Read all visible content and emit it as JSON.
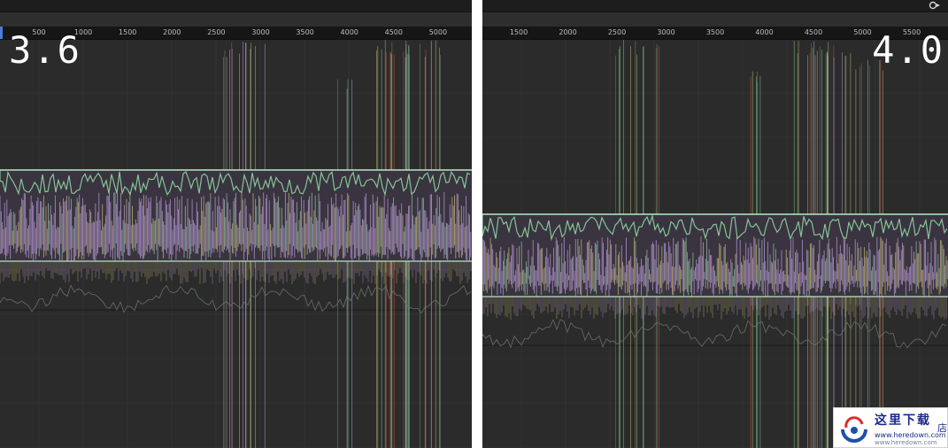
{
  "left_panel": {
    "version_label": "3.6",
    "ruler_ticks": [
      "500",
      "1000",
      "1500",
      "2000",
      "2500",
      "3000",
      "3500",
      "4000",
      "4500",
      "5000"
    ]
  },
  "right_panel": {
    "version_label": "4.0",
    "ruler_ticks": [
      "1500",
      "2000",
      "2500",
      "3000",
      "3500",
      "4000",
      "4500",
      "5000",
      "5500"
    ],
    "toolbar_icon": "render-settings-icon"
  },
  "watermark": {
    "title": "这里下载",
    "url": "www.heredown.com",
    "url_faint": "www.heredown.com",
    "side_char": "店"
  },
  "colors": {
    "background": "#2b2b2b",
    "ruler": "#161616",
    "curve_green": "#8fd4a0",
    "curve_purple": "#c8a8e8",
    "curve_yellow": "#d8c878",
    "curve_red": "#d85858",
    "frame_marker": "#4a7cd8"
  }
}
